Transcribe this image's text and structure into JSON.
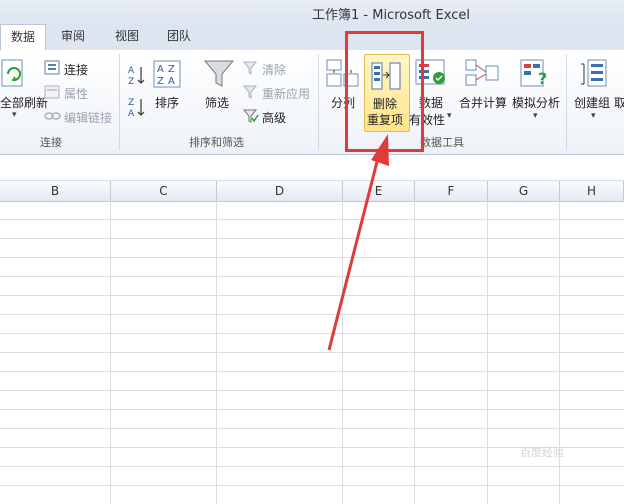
{
  "window": {
    "title": "工作簿1 - Microsoft Excel"
  },
  "tabs": [
    {
      "label": "数据",
      "active": true
    },
    {
      "label": "审阅"
    },
    {
      "label": "视图"
    },
    {
      "label": "团队"
    }
  ],
  "ribbon": {
    "connections": {
      "refresh_all": "全部刷新",
      "connections": "连接",
      "properties": "属性",
      "edit_links": "编辑链接",
      "group_label": "连接"
    },
    "sort_filter": {
      "sort": "排序",
      "filter": "筛选",
      "clear": "清除",
      "reapply": "重新应用",
      "advanced": "高级",
      "group_label": "排序和筛选"
    },
    "data_tools": {
      "text_to_columns": "分列",
      "remove_duplicates_line1": "删除",
      "remove_duplicates_line2": "重复项",
      "data_validation_line1": "数据",
      "data_validation_line2": "有效性",
      "consolidate": "合并计算",
      "what_if": "模拟分析",
      "group_label": "数据工具"
    },
    "outline": {
      "group": "创建组",
      "ungroup_partial": "取"
    }
  },
  "columns": [
    "B",
    "C",
    "D",
    "E",
    "F",
    "G",
    "H"
  ],
  "watermark": "百度经验",
  "colors": {
    "highlight_box": "#e23a3a",
    "arrow": "#e23a3a"
  }
}
